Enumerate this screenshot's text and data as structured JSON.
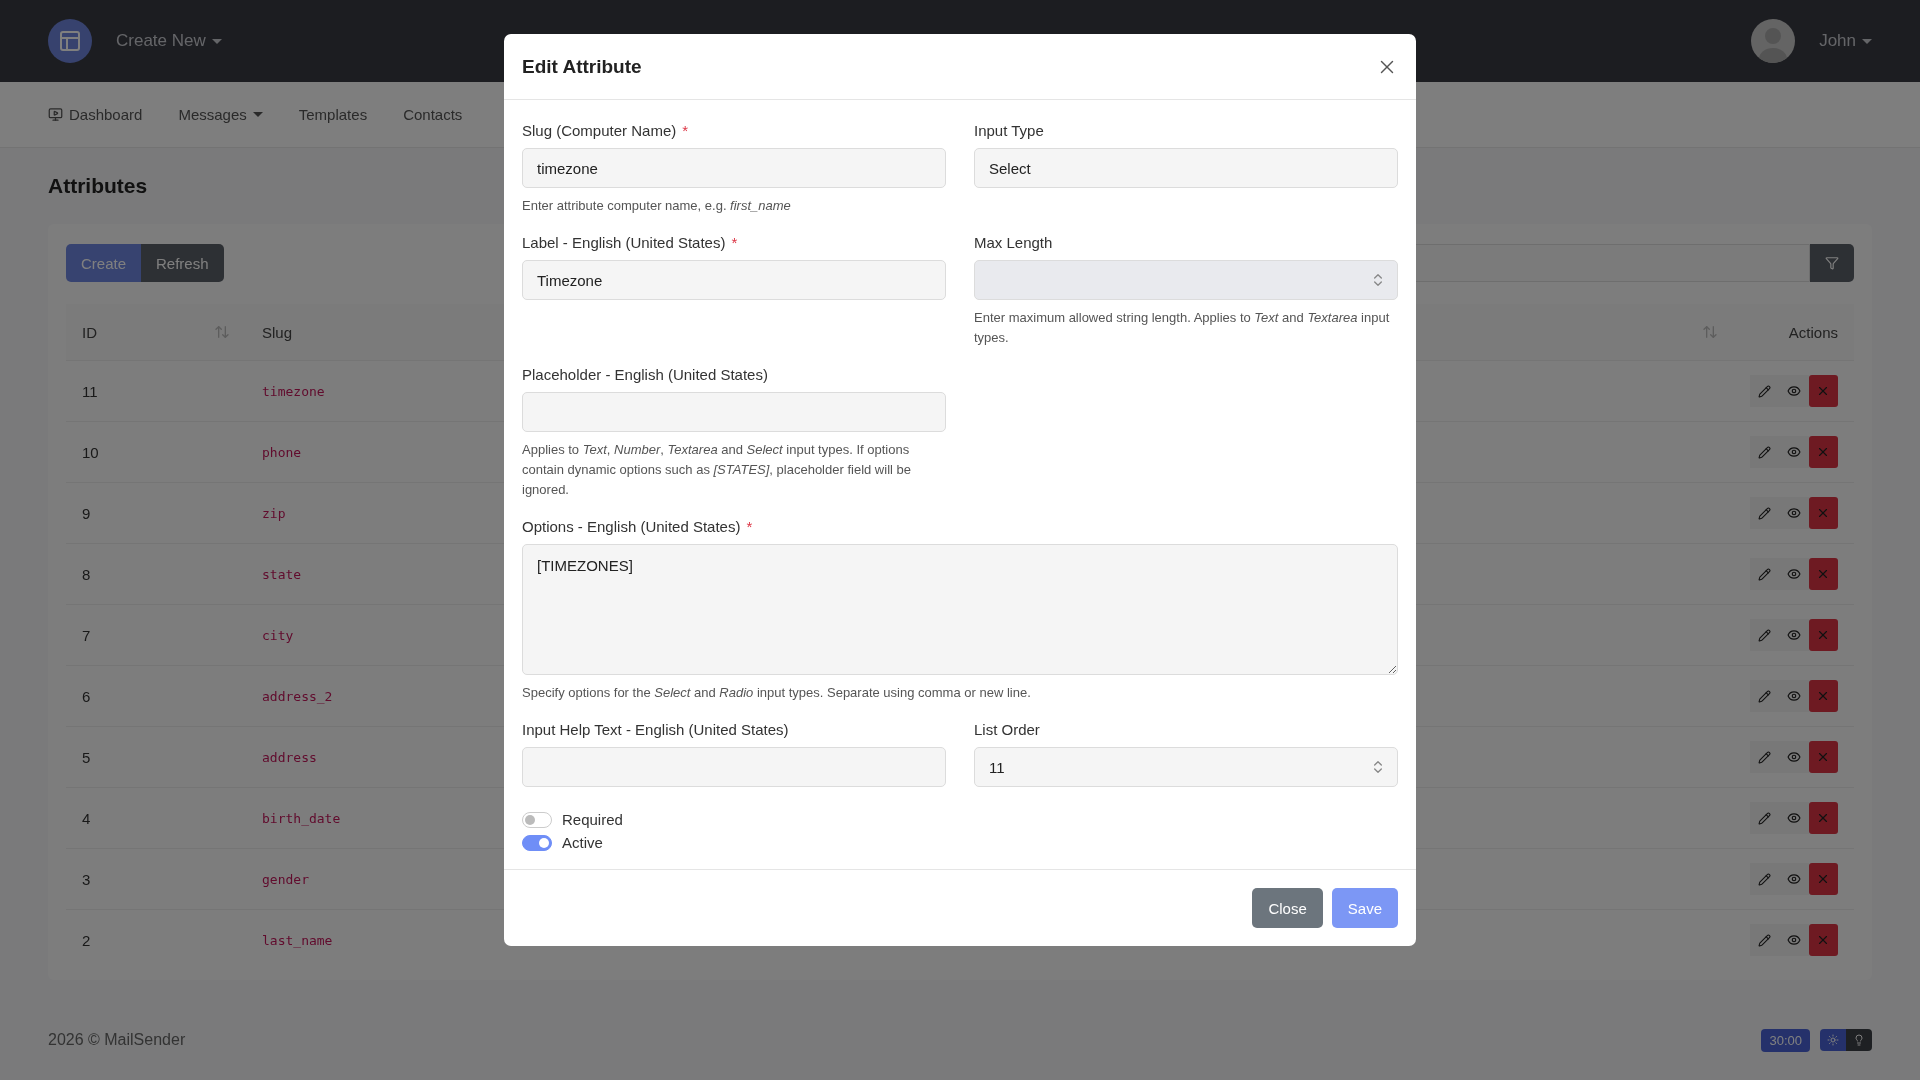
{
  "navbar": {
    "create_menu": "Create New",
    "user": "John"
  },
  "tabs": [
    {
      "label": "Dashboard",
      "dropdown": false
    },
    {
      "label": "Messages",
      "dropdown": true
    },
    {
      "label": "Templates",
      "dropdown": false
    },
    {
      "label": "Contacts",
      "dropdown": false
    }
  ],
  "page_title": "Attributes",
  "toolbar": {
    "buttons": [
      {
        "label": "Create",
        "kind": "primary"
      },
      {
        "label": "Refresh",
        "kind": "secondary"
      }
    ]
  },
  "table": {
    "columns": [
      {
        "label": "ID",
        "sortable": true
      },
      {
        "label": "Slug",
        "sortable": false
      },
      {
        "sortable": true
      },
      {
        "label": "Actions",
        "sortable": false
      }
    ],
    "rows": [
      {
        "id": "11",
        "slug": "timezone"
      },
      {
        "id": "10",
        "slug": "phone"
      },
      {
        "id": "9",
        "slug": "zip"
      },
      {
        "id": "8",
        "slug": "state"
      },
      {
        "id": "7",
        "slug": "city"
      },
      {
        "id": "6",
        "slug": "address_2"
      },
      {
        "id": "5",
        "slug": "address"
      },
      {
        "id": "4",
        "slug": "birth_date"
      },
      {
        "id": "3",
        "slug": "gender"
      },
      {
        "id": "2",
        "slug": "last_name"
      }
    ]
  },
  "footer": {
    "copyright": "2026 © MailSender",
    "timer": "30:00",
    "theme": [
      {
        "selected": true
      },
      {
        "selected": false
      }
    ]
  },
  "modal": {
    "title": "Edit Attribute",
    "rows": [
      [
        {
          "label": "Slug (Computer Name)",
          "required_mark": "*",
          "kind": "text",
          "value": "timezone",
          "help": "Enter attribute computer name, e.g. *first_name*"
        },
        {
          "label": "Input Type",
          "kind": "select",
          "value": "Select"
        }
      ],
      [
        {
          "label": "Label - English (United States)",
          "required_mark": "*",
          "kind": "text",
          "value": "Timezone"
        },
        {
          "label": "Max Length",
          "kind": "number",
          "disabled": true,
          "help": "Enter maximum allowed string length. Applies to *Text* and *Textarea* input types."
        }
      ],
      [
        {
          "label": "Placeholder - English (United States)",
          "kind": "text",
          "help": "Applies to *Text*, *Number*, *Textarea* and *Select* input types. If options contain dynamic options such as *[STATES]*, placeholder field will be ignored."
        }
      ],
      [
        {
          "label": "Options - English (United States)",
          "required_mark": "*",
          "kind": "textarea",
          "value": "[TIMEZONES]",
          "help": "Specify options for the *Select* and *Radio* input types. Separate using comma or new line."
        }
      ],
      [
        {
          "label": "Input Help Text - English (United States)",
          "kind": "text"
        },
        {
          "label": "List Order",
          "kind": "number",
          "disabled": false,
          "value": "11"
        }
      ]
    ],
    "toggles": [
      {
        "label": "Required",
        "on": false
      },
      {
        "label": "Active",
        "on": true
      }
    ],
    "buttons": [
      {
        "label": "Close",
        "kind": "secondary"
      },
      {
        "label": "Save",
        "kind": "primary"
      }
    ]
  }
}
